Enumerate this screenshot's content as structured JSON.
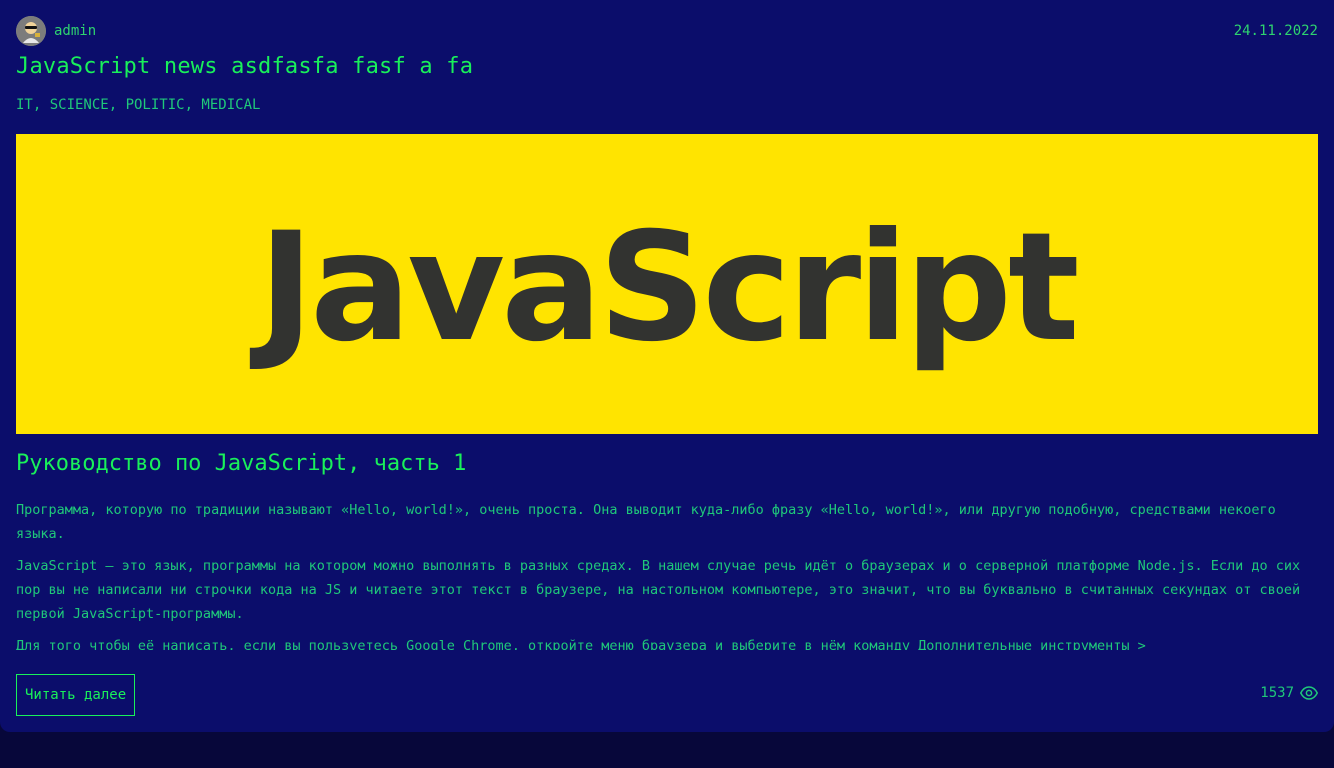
{
  "post": {
    "author": "admin",
    "date": "24.11.2022",
    "title": "JavaScript news asdfasfa fasf a fa",
    "categories": "IT, SCIENCE, POLITIC, MEDICAL",
    "image_text": "JavaScript",
    "subtitle": "Руководство по JavaScript, часть 1",
    "paragraphs": [
      "Программа, которую по традиции называют «Hello, world!», очень проста. Она выводит куда-либо фразу «Hello, world!», или другую подобную, средствами некоего языка.",
      "JavaScript — это язык, программы на котором можно выполнять в разных средах. В нашем случае речь идёт о браузерах и о серверной платформе Node.js. Если до сих пор вы не написали ни строчки кода на JS и читаете этот текст в браузере, на настольном компьютере, это значит, что вы буквально в считанных секундах от своей первой JavaScript-программы.",
      "Для того чтобы её написать, если вы пользуетесь Google Chrome, откройте меню браузера и выберите в нём команду Дополнительные инструменты >"
    ],
    "read_more_label": "Читать далее",
    "views": "1537"
  },
  "colors": {
    "background": "#0b0d6b",
    "accent": "#19f05a",
    "hero_bg": "#ffe400"
  },
  "icons": {
    "avatar": "avatar-image",
    "views": "eye-icon"
  }
}
